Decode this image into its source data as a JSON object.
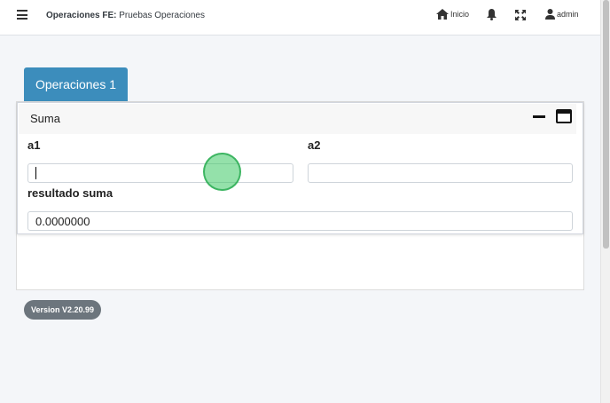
{
  "header": {
    "app_name": "Operaciones FE:",
    "page_name": "Pruebas Operaciones",
    "home_label": "Inicio",
    "user_label": "admin"
  },
  "tabs": [
    {
      "label": "Operaciones 1"
    }
  ],
  "card": {
    "title": "Suma",
    "fields": {
      "a1": {
        "label": "a1",
        "value": ""
      },
      "a2": {
        "label": "a2",
        "value": ""
      },
      "resultado": {
        "label": "resultado suma",
        "value": "0.0000000"
      }
    }
  },
  "footer": {
    "version": "Version V2.20.99"
  },
  "icons": [
    "menu-icon",
    "home-icon",
    "bell-icon",
    "expand-icon",
    "user-icon",
    "minimize-icon",
    "maximize-icon"
  ],
  "colors": {
    "tab_active": "#3c8dbc",
    "version_badge": "#6c757d",
    "click_marker": "#3cc864"
  }
}
